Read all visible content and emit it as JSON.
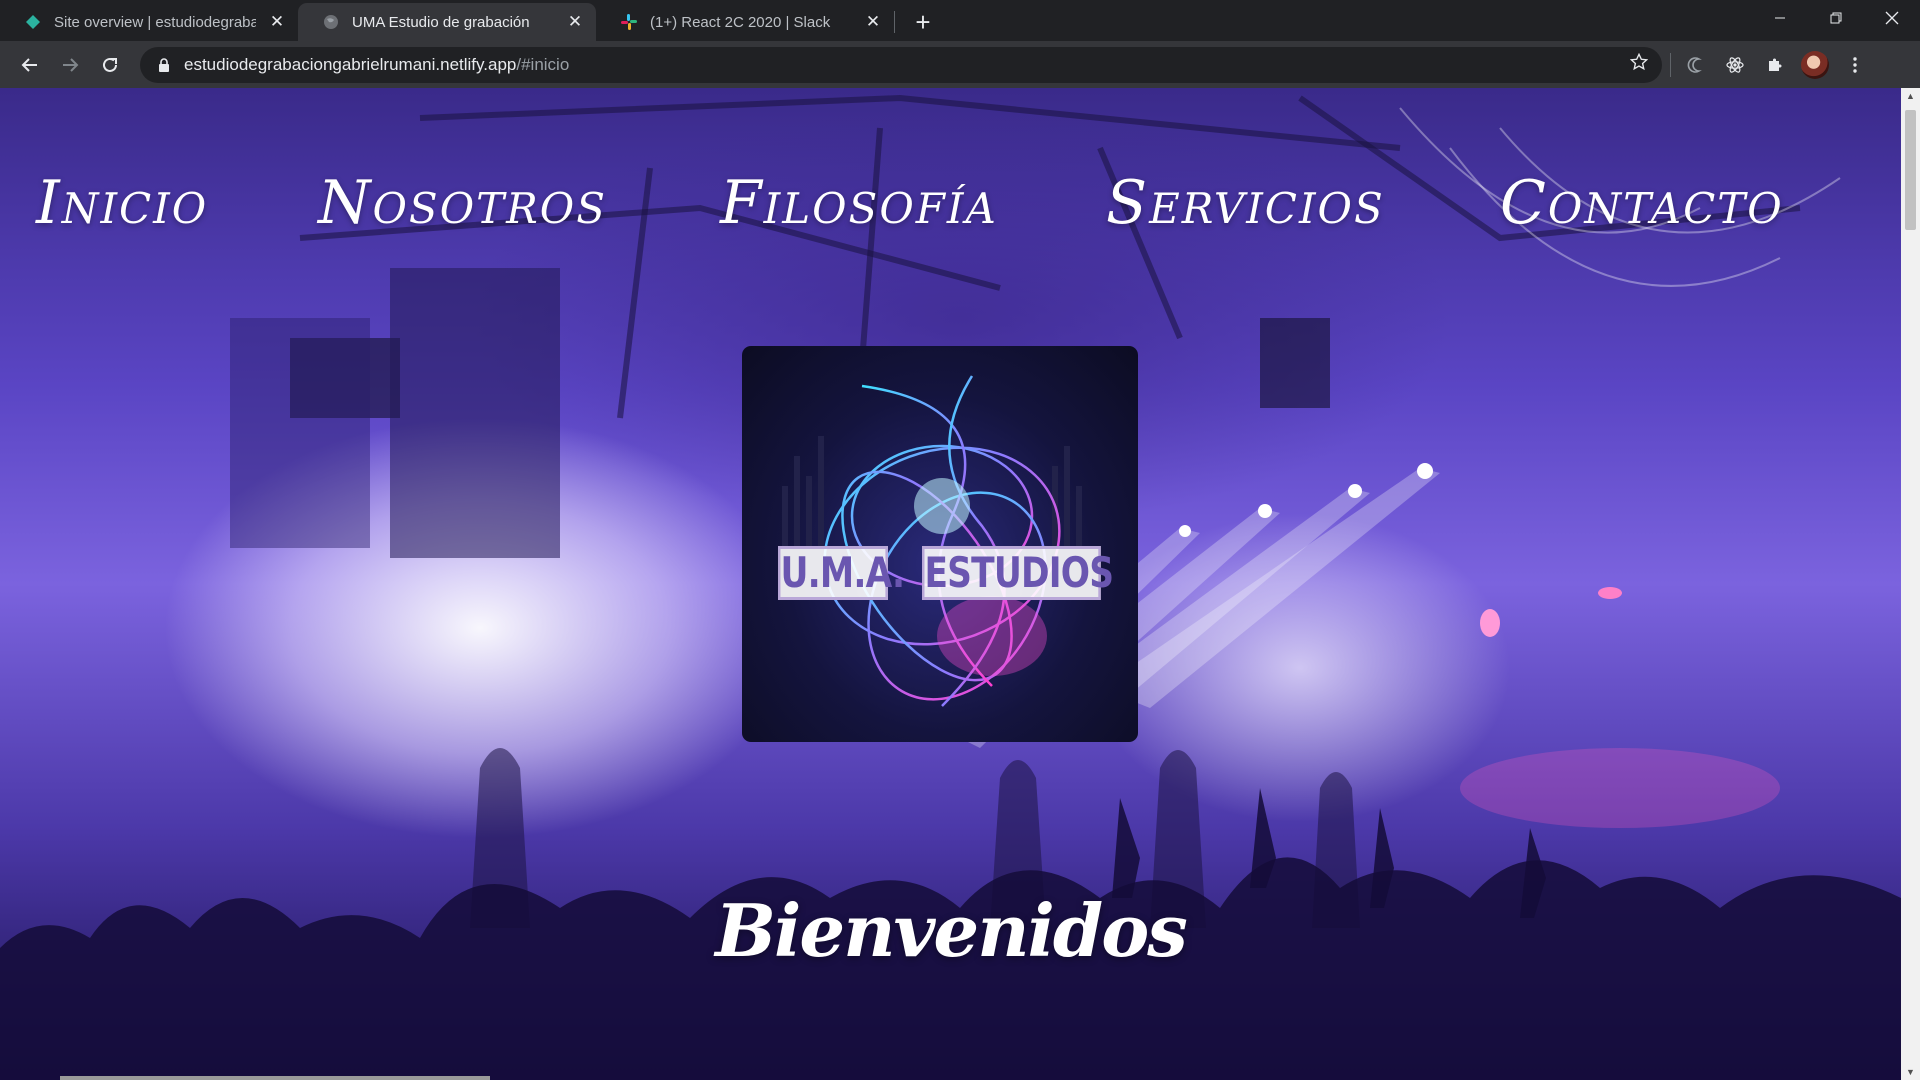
{
  "browser": {
    "tabs": [
      {
        "title": "Site overview | estudiodegrabacionga",
        "favicon": "netlify-diamond-icon",
        "active": false
      },
      {
        "title": "UMA Estudio de grabación",
        "favicon": "globe-icon",
        "active": true
      },
      {
        "title": "(1+) React 2C 2020 | Slack",
        "favicon": "slack-icon",
        "active": false
      }
    ],
    "new_tab_label": "+",
    "url_host": "estudiodegrabaciongabrielrumani.netlify.app",
    "url_path": "/#inicio"
  },
  "site": {
    "nav": [
      "Inicio",
      "Nosotros",
      "Filosofía",
      "Servicios",
      "Contacto"
    ],
    "logo": {
      "text_left": "U.M.A.",
      "text_right": "ESTUDIOS"
    },
    "welcome": "Bienvenidos"
  },
  "colors": {
    "chrome_dark": "#202124",
    "chrome_toolbar": "#35363a",
    "stage_purple": "#5a45c4",
    "logo_text": "#6a56b0"
  }
}
